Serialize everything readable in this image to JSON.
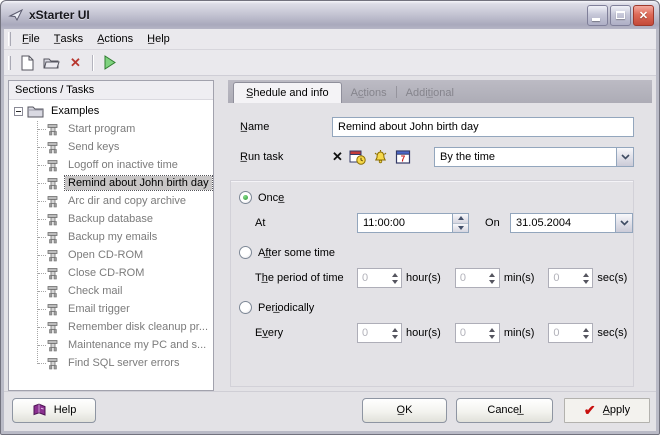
{
  "window": {
    "title": "xStarter UI"
  },
  "menu": {
    "items": [
      "F̲ile",
      "T̲asks",
      "A̲ctions",
      "H̲elp"
    ]
  },
  "toolbar": {
    "buttons": [
      "new-document-icon",
      "open-folder-icon",
      "delete-icon",
      "run-icon"
    ]
  },
  "sidebar": {
    "header": "Sections / Tasks",
    "root_label": "Examples",
    "items": [
      "Start program",
      "Send keys",
      "Logoff on inactive time",
      "Remind about John birth day",
      "Arc dir and copy archive",
      "Backup database",
      "Backup my emails",
      "Open CD-ROM",
      "Close CD-ROM",
      "Check mail",
      "Email trigger",
      "Remember disk cleanup pr...",
      "Maintenance my PC and s...",
      "Find SQL server errors"
    ],
    "selected_index": 3
  },
  "tabs": {
    "schedule": "S̲hedule and info",
    "actions": "Ac̲tions",
    "additional": "Addit̲ional",
    "active": "Shedule and info"
  },
  "form": {
    "name_label": "N̲ame",
    "name_value": "Remind about John birth day",
    "run_task_label": "R̲un task",
    "run_task_icons": [
      "no-schedule-icon",
      "date-time-icon",
      "alarm-bell-icon",
      "calendar-icon"
    ],
    "run_task_value": "By the time",
    "schedule": {
      "once": {
        "label": "Once̲",
        "selected": true,
        "at_label": "At",
        "time": "11:00:00",
        "on_label": "On",
        "date": "31.05.2004"
      },
      "after": {
        "label": "Af̲ter some time",
        "selected": false,
        "period_label": "Th̲e period of time",
        "hours": "0",
        "hours_suffix": "hour(s)",
        "minutes": "0",
        "minutes_suffix": "min(s)",
        "seconds": "0",
        "seconds_suffix": "sec(s)"
      },
      "periodically": {
        "label": "Peri̲odically",
        "selected": false,
        "every_label": "Ev̲ery",
        "hours": "0",
        "hours_suffix": "hour(s)",
        "minutes": "0",
        "minutes_suffix": "min(s)",
        "seconds": "0",
        "seconds_suffix": "sec(s)"
      }
    }
  },
  "footer": {
    "help": "Help",
    "ok": "O̲K",
    "cancel": "Cancel̲",
    "apply": "A̲pply"
  },
  "colors": {
    "face": "#e3e2e6",
    "titlebar_silver": "#b6b6c6",
    "close_red": "#c44938",
    "selection_gray": "#c8c6c6",
    "edit_border": "#93a6bd",
    "radio_green": "#2e9634",
    "apply_check_red": "#c8100e",
    "run_green": "#7fd27f",
    "delete_red": "#b8372f",
    "help_book_purple": "#8b3090"
  }
}
